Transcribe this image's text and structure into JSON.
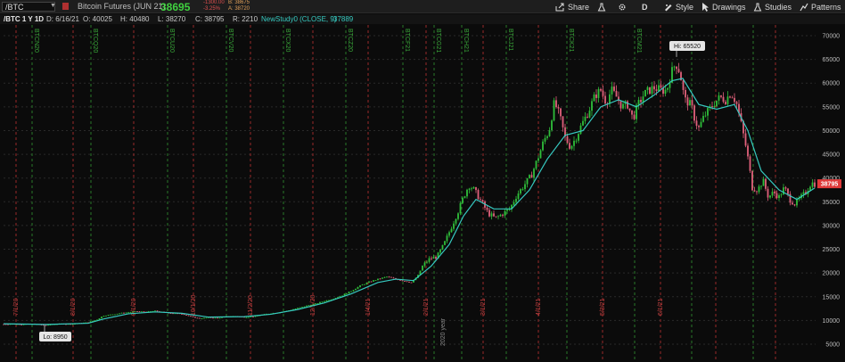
{
  "toolbar": {
    "symbol": "/BTC",
    "instrument_name": "Bitcoin Futures (JUN 21)",
    "last_price": "38695",
    "net_change": "-1300.00",
    "pct_change": "-3.25%",
    "bid": "B: 38675",
    "ask": "A: 38720",
    "share_label": "Share",
    "period_label": "D",
    "style_label": "Style",
    "drawings_label": "Drawings",
    "studies_label": "Studies",
    "patterns_label": "Patterns"
  },
  "infobar": {
    "chart_title": "/BTC 1 Y 1D",
    "date": "D: 6/16/21",
    "open": "O: 40025",
    "high": "H: 40480",
    "low": "L: 38270",
    "close": "C: 38795",
    "range": "R: 2210",
    "study_name": "NewStudy0 (CLOSE, 9)",
    "study_value": "37889"
  },
  "colors": {
    "up_candle": "#2fbf3a",
    "down_candle": "#e0607a",
    "ema_line": "#36c9c0",
    "vline_red": "#9a2a2a",
    "vline_green": "#2a7a2a",
    "price_tag": "#e03a3a"
  },
  "chart_data": {
    "type": "candlestick",
    "y_axis_labels": [
      "70000",
      "65000",
      "60000",
      "55000",
      "50000",
      "45000",
      "40000",
      "35000",
      "30000",
      "25000",
      "20000",
      "15000",
      "10000",
      "5000"
    ],
    "ylim": [
      3000,
      72000
    ],
    "current_price_tag": "38795",
    "hi_label": "Hi: 65520",
    "lo_label": "Lo: 8950",
    "year_label": "2020 year",
    "study": "NewStudy0 (CLOSE, 9)",
    "top_markers": [
      "BTCN20",
      "BTCQ20",
      "BTCU20",
      "BTCV20",
      "BTCX20",
      "BTCZ20",
      "BTCF21",
      "BTCG21",
      "BTCH21",
      "BTCJ21",
      "BTCK21",
      "BTCM21"
    ],
    "bottom_markers": [
      "7/1/20",
      "8/1/20",
      "9/1/20",
      "10/1/20",
      "11/2/20",
      "12/1/20",
      "1/4/21",
      "2/1/21",
      "3/1/21",
      "4/1/21",
      "5/3/21",
      "6/1/21"
    ],
    "close_path": [
      [
        0,
        9200
      ],
      [
        10,
        9250
      ],
      [
        20,
        9150
      ],
      [
        30,
        9300
      ],
      [
        40,
        9100
      ],
      [
        48,
        8950
      ],
      [
        55,
        9200
      ],
      [
        65,
        9300
      ],
      [
        75,
        9200
      ],
      [
        85,
        9400
      ],
      [
        95,
        9600
      ],
      [
        105,
        10200
      ],
      [
        112,
        11000
      ],
      [
        120,
        11200
      ],
      [
        130,
        11500
      ],
      [
        140,
        11700
      ],
      [
        150,
        11900
      ],
      [
        160,
        11800
      ],
      [
        170,
        12000
      ],
      [
        180,
        11700
      ],
      [
        190,
        11500
      ],
      [
        200,
        11400
      ],
      [
        210,
        10800
      ],
      [
        220,
        10400
      ],
      [
        230,
        10600
      ],
      [
        240,
        10500
      ],
      [
        250,
        10800
      ],
      [
        260,
        10900
      ],
      [
        270,
        10700
      ],
      [
        280,
        10800
      ],
      [
        290,
        11200
      ],
      [
        300,
        11500
      ],
      [
        310,
        11700
      ],
      [
        320,
        12100
      ],
      [
        330,
        12600
      ],
      [
        340,
        13100
      ],
      [
        350,
        13500
      ],
      [
        360,
        14100
      ],
      [
        370,
        14600
      ],
      [
        380,
        15300
      ],
      [
        390,
        16200
      ],
      [
        400,
        17300
      ],
      [
        410,
        18100
      ],
      [
        420,
        18700
      ],
      [
        430,
        19200
      ],
      [
        440,
        18700
      ],
      [
        450,
        18300
      ],
      [
        458,
        18000
      ],
      [
        465,
        19500
      ],
      [
        470,
        21500
      ],
      [
        478,
        23000
      ],
      [
        486,
        23400
      ],
      [
        494,
        26000
      ],
      [
        502,
        29500
      ],
      [
        510,
        33000
      ],
      [
        516,
        36000
      ],
      [
        522,
        38500
      ],
      [
        528,
        37500
      ],
      [
        536,
        35000
      ],
      [
        544,
        32500
      ],
      [
        552,
        31500
      ],
      [
        560,
        32500
      ],
      [
        568,
        33500
      ],
      [
        576,
        36500
      ],
      [
        584,
        38500
      ],
      [
        592,
        40500
      ],
      [
        600,
        44500
      ],
      [
        606,
        47800
      ],
      [
        612,
        50000
      ],
      [
        618,
        56000
      ],
      [
        624,
        53000
      ],
      [
        630,
        48500
      ],
      [
        636,
        46500
      ],
      [
        642,
        48500
      ],
      [
        648,
        51000
      ],
      [
        656,
        54000
      ],
      [
        664,
        57500
      ],
      [
        670,
        58500
      ],
      [
        676,
        56000
      ],
      [
        682,
        58500
      ],
      [
        688,
        57000
      ],
      [
        694,
        55000
      ],
      [
        700,
        55500
      ],
      [
        706,
        52500
      ],
      [
        712,
        55500
      ],
      [
        718,
        57500
      ],
      [
        724,
        58500
      ],
      [
        730,
        59000
      ],
      [
        738,
        58500
      ],
      [
        744,
        58500
      ],
      [
        748,
        61500
      ],
      [
        752,
        63500
      ],
      [
        756,
        64000
      ],
      [
        760,
        61000
      ],
      [
        764,
        56500
      ],
      [
        768,
        56000
      ],
      [
        772,
        55000
      ],
      [
        776,
        52000
      ],
      [
        780,
        50500
      ],
      [
        786,
        53000
      ],
      [
        792,
        54500
      ],
      [
        798,
        56000
      ],
      [
        804,
        57000
      ],
      [
        810,
        56500
      ],
      [
        816,
        58000
      ],
      [
        822,
        56000
      ],
      [
        828,
        51000
      ],
      [
        834,
        45500
      ],
      [
        840,
        38000
      ],
      [
        846,
        37500
      ],
      [
        852,
        39500
      ],
      [
        858,
        36000
      ],
      [
        864,
        37000
      ],
      [
        870,
        36000
      ],
      [
        876,
        38000
      ],
      [
        882,
        35500
      ],
      [
        888,
        34500
      ],
      [
        894,
        35800
      ],
      [
        900,
        37000
      ],
      [
        906,
        39000
      ],
      [
        910,
        38795
      ]
    ],
    "ema_path": [
      [
        0,
        9300
      ],
      [
        48,
        9150
      ],
      [
        95,
        9400
      ],
      [
        112,
        10300
      ],
      [
        140,
        11400
      ],
      [
        170,
        11800
      ],
      [
        200,
        11500
      ],
      [
        230,
        10700
      ],
      [
        270,
        10800
      ],
      [
        300,
        11300
      ],
      [
        330,
        12300
      ],
      [
        360,
        13700
      ],
      [
        390,
        15600
      ],
      [
        420,
        18000
      ],
      [
        440,
        18700
      ],
      [
        460,
        18400
      ],
      [
        480,
        21500
      ],
      [
        500,
        26000
      ],
      [
        516,
        32000
      ],
      [
        530,
        35500
      ],
      [
        550,
        33500
      ],
      [
        570,
        33500
      ],
      [
        590,
        37500
      ],
      [
        610,
        44000
      ],
      [
        630,
        49000
      ],
      [
        650,
        50000
      ],
      [
        670,
        55000
      ],
      [
        690,
        56500
      ],
      [
        710,
        55000
      ],
      [
        730,
        57500
      ],
      [
        750,
        60500
      ],
      [
        762,
        61000
      ],
      [
        780,
        55500
      ],
      [
        800,
        54500
      ],
      [
        820,
        55500
      ],
      [
        835,
        50000
      ],
      [
        850,
        41500
      ],
      [
        870,
        37500
      ],
      [
        890,
        35500
      ],
      [
        910,
        37889
      ]
    ]
  }
}
